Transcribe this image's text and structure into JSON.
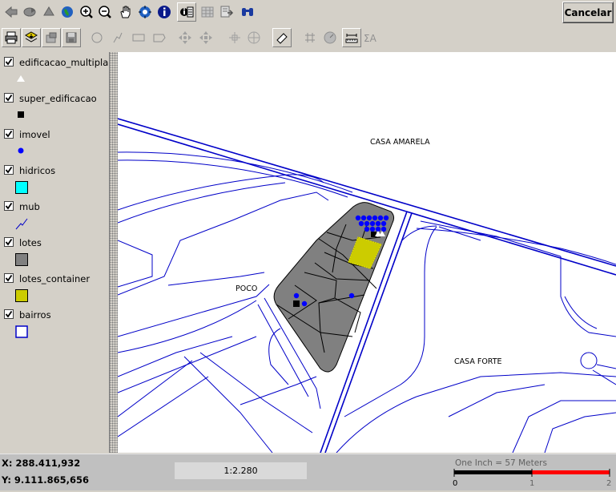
{
  "toolbar": {
    "row1_icons": [
      "back-arrow-icon",
      "forward-arrow-icon",
      "up-arrow-icon",
      "globe-icon",
      "zoom-in-icon",
      "zoom-out-icon",
      "pan-hand-icon",
      "full-extent-icon",
      "info-icon",
      "identify-icon",
      "attribute-table-icon",
      "export-icon",
      "find-binoculars-icon"
    ],
    "row2_icons": [
      "print-icon",
      "add-layer-icon",
      "layer-properties-icon",
      "save-icon",
      "select-circle-icon",
      "select-line-icon",
      "select-rectangle-icon",
      "select-polygon-icon",
      "move-icon",
      "move-vertex-icon",
      "snap-grid-icon",
      "crosshair-icon",
      "eraser-icon",
      "grid-icon",
      "compass-icon",
      "measure-icon",
      "sigma-icon"
    ],
    "cancel_label": "Cancelar"
  },
  "legend": {
    "layers": [
      {
        "name": "edificacao_multipla",
        "checked": true,
        "symbol": "white-triangle-icon"
      },
      {
        "name": "super_edificacao",
        "checked": true,
        "symbol": "black-square-icon"
      },
      {
        "name": "imovel",
        "checked": true,
        "symbol": "blue-dot-icon"
      },
      {
        "name": "hidricos",
        "checked": true,
        "symbol": "cyan-square-icon"
      },
      {
        "name": "mub",
        "checked": true,
        "symbol": "blue-line-icon"
      },
      {
        "name": "lotes",
        "checked": true,
        "symbol": "gray-square-icon"
      },
      {
        "name": "lotes_container",
        "checked": true,
        "symbol": "yellow-square-icon"
      },
      {
        "name": "bairros",
        "checked": true,
        "symbol": "blue-outline-square-icon"
      }
    ]
  },
  "map": {
    "labels": {
      "casa_amarela": "CASA AMARELA",
      "poco": "POCO",
      "casa_forte": "CASA FORTE"
    },
    "colors": {
      "street": "#0000c8",
      "lot_fill": "#808080",
      "selected": "#cccc00",
      "point": "#0000ff"
    }
  },
  "status": {
    "x_coord": "X: 288.411,932",
    "y_coord": "Y: 9.111.865,656",
    "scale": "1:2.280",
    "scalebar_label": "One Inch = 57 Meters",
    "scalebar_ticks": [
      "0",
      "1",
      "2"
    ]
  }
}
